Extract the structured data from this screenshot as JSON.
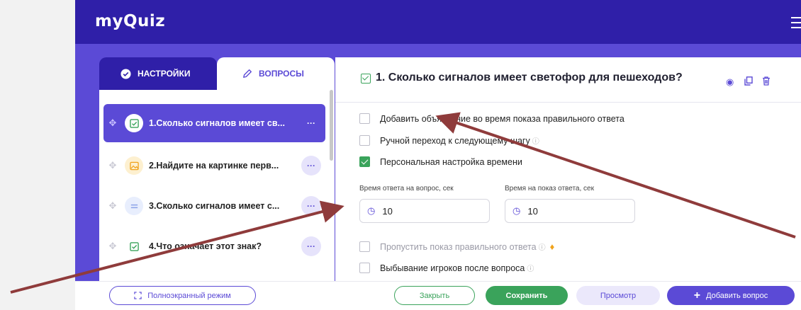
{
  "app": {
    "logo": "myQuiz"
  },
  "sidebar": {
    "tabs": [
      {
        "label": "НАСТРОЙКИ"
      },
      {
        "label": "ВОПРОСЫ"
      }
    ],
    "questions": [
      {
        "title": "1.Сколько сигналов имеет св...",
        "icon": "checkbox-icon"
      },
      {
        "title": "2.Найдите на картинке перв...",
        "icon": "image-icon"
      },
      {
        "title": "3.Сколько сигналов имеет с...",
        "icon": "text-icon"
      },
      {
        "title": "4.Что означает этот знак?",
        "icon": "checkbox-icon"
      }
    ],
    "more_label": "···"
  },
  "question": {
    "title": "1. Сколько сигналов имеет светофор для пешеходов?",
    "options": [
      {
        "label": "Добавить объяснение во время показа правильного ответа",
        "checked": false
      },
      {
        "label": "Ручной переход к следующему шагу",
        "checked": false
      },
      {
        "label": "Персональная настройка времени",
        "checked": true
      }
    ],
    "answer_time": {
      "label": "Время ответа на вопрос, сек",
      "value": "10"
    },
    "show_time": {
      "label": "Время на показ ответа, сек",
      "value": "10"
    },
    "extra_options": [
      {
        "label": "Пропустить показ правильного ответа",
        "checked": false,
        "premium": true
      },
      {
        "label": "Выбывание игроков после вопроса",
        "checked": false
      }
    ]
  },
  "footer": {
    "fullscreen": "Полноэкранный режим",
    "close": "Закрыть",
    "save": "Сохранить",
    "preview": "Просмотр",
    "add": "Добавить вопрос"
  },
  "colors": {
    "accent": "#5b4ad6",
    "header": "#2f1fa8",
    "success": "#3aa35b",
    "annotation_arrow": "#8f3b3b"
  }
}
